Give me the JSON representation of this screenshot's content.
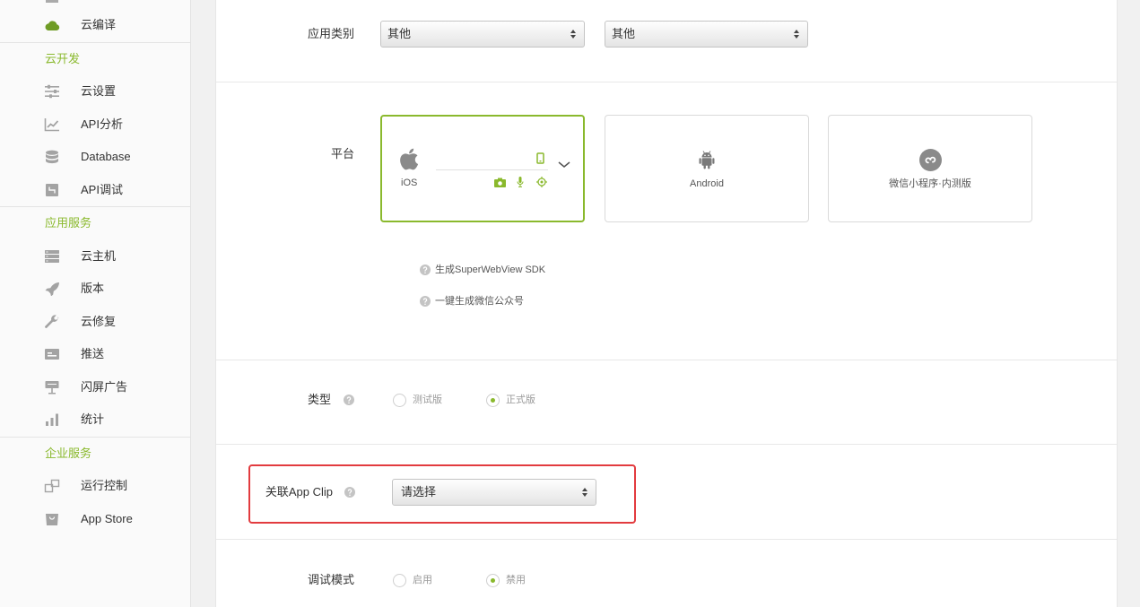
{
  "sidebar": {
    "current": {
      "label": "云编译",
      "icon": "cloud-icon",
      "active": true
    },
    "sections": [
      {
        "title": "云开发",
        "items": [
          {
            "label": "云设置",
            "icon": "sliders-icon"
          },
          {
            "label": "API分析",
            "icon": "chart-icon"
          },
          {
            "label": "Database",
            "icon": "database-icon"
          },
          {
            "label": "API调试",
            "icon": "api-debug-icon"
          }
        ]
      },
      {
        "title": "应用服务",
        "items": [
          {
            "label": "云主机",
            "icon": "server-icon"
          },
          {
            "label": "版本",
            "icon": "rocket-icon"
          },
          {
            "label": "云修复",
            "icon": "wrench-icon"
          },
          {
            "label": "推送",
            "icon": "push-icon"
          },
          {
            "label": "闪屏广告",
            "icon": "ad-board-icon"
          },
          {
            "label": "统计",
            "icon": "bar-chart-icon"
          }
        ]
      },
      {
        "title": "企业服务",
        "items": [
          {
            "label": "运行控制",
            "icon": "run-control-icon"
          },
          {
            "label": "App Store",
            "icon": "app-store-icon"
          }
        ]
      }
    ]
  },
  "form": {
    "app_category": {
      "label": "应用类别",
      "select_1": "其他",
      "select_2": "其他"
    },
    "platform": {
      "label": "平台",
      "cards": [
        {
          "name": "iOS",
          "icon": "apple-icon",
          "selected": true
        },
        {
          "name": "Android",
          "icon": "android-icon",
          "selected": false
        },
        {
          "name": "微信小程序·内测版",
          "icon": "mini-program-icon",
          "selected": false
        }
      ],
      "ios_features": [
        "phone-icon",
        "camera-icon",
        "mic-icon",
        "location-icon"
      ],
      "links": [
        "生成SuperWebView SDK",
        "一键生成微信公众号"
      ]
    },
    "type": {
      "label": "类型",
      "options": [
        {
          "label": "测试版",
          "checked": false
        },
        {
          "label": "正式版",
          "checked": true
        }
      ]
    },
    "app_clip": {
      "label": "关联App Clip",
      "value": "请选择"
    },
    "debug_mode": {
      "label": "调试模式",
      "options": [
        {
          "label": "启用",
          "checked": false
        },
        {
          "label": "禁用",
          "checked": true
        }
      ]
    }
  },
  "colors": {
    "accent": "#8ab92d",
    "highlight": "#e23b3f",
    "active_icon": "#6f9c25"
  }
}
